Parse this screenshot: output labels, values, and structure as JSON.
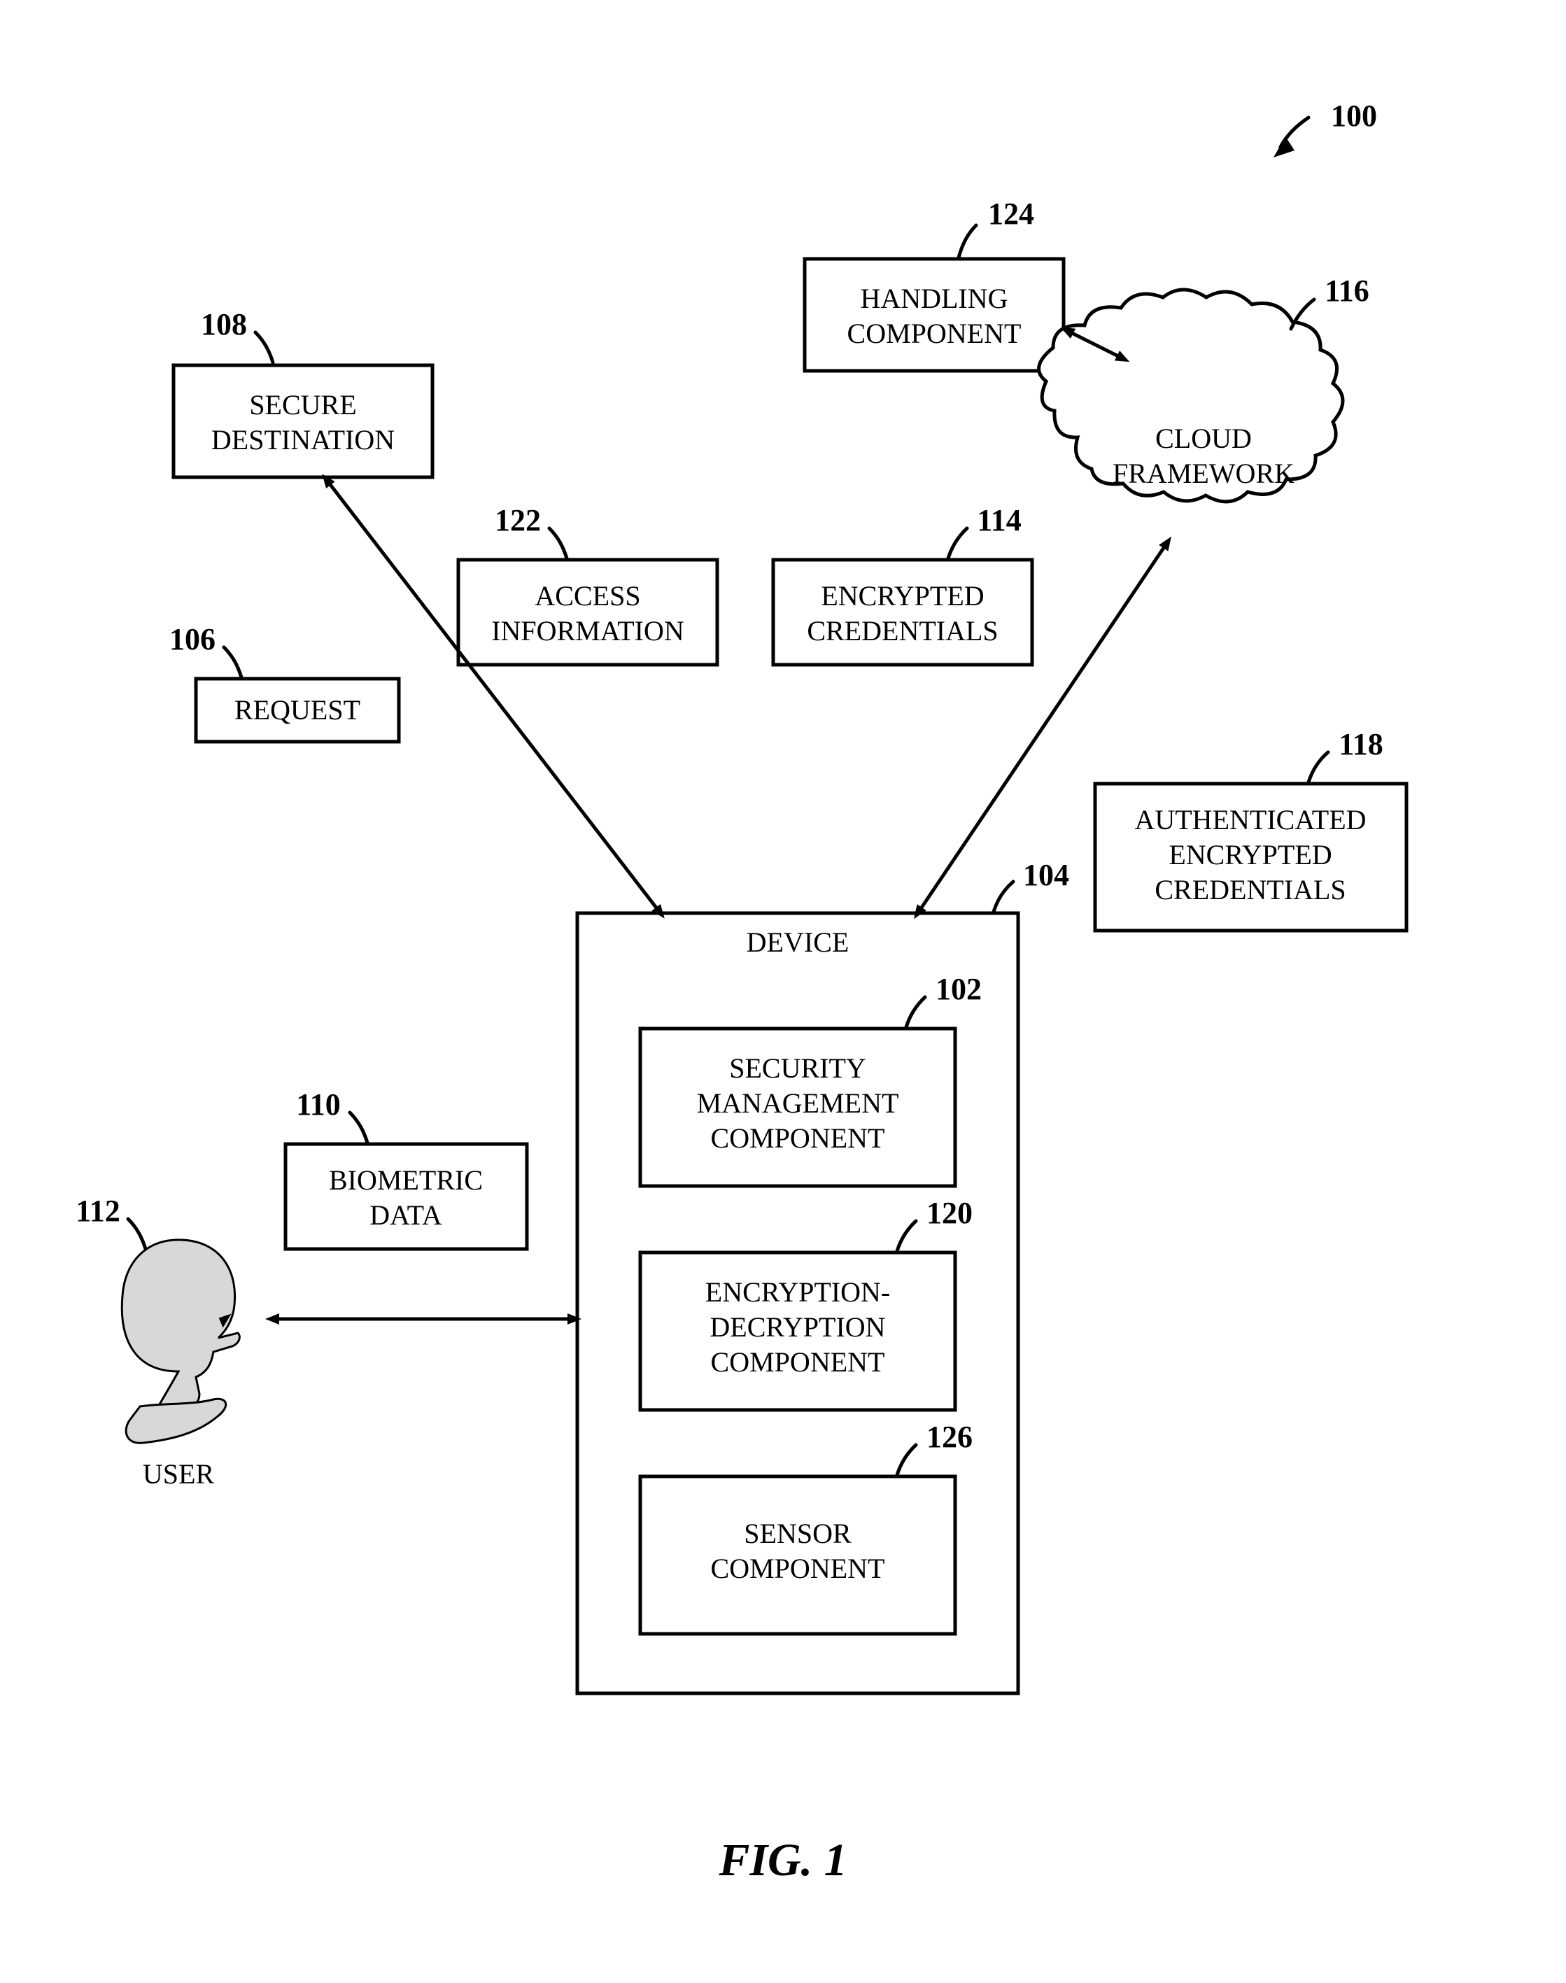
{
  "figure_caption": "FIG. 1",
  "diagram_ref": "100",
  "nodes": {
    "secure_destination": {
      "label_l1": "SECURE",
      "label_l2": "DESTINATION",
      "ref": "108"
    },
    "handling_component": {
      "label_l1": "HANDLING",
      "label_l2": "COMPONENT",
      "ref": "124"
    },
    "cloud": {
      "label_l1": "CLOUD",
      "label_l2": "FRAMEWORK",
      "ref": "116"
    },
    "access_info": {
      "label_l1": "ACCESS",
      "label_l2": "INFORMATION",
      "ref": "122"
    },
    "encrypted_credentials": {
      "label_l1": "ENCRYPTED",
      "label_l2": "CREDENTIALS",
      "ref": "114"
    },
    "request": {
      "label": "REQUEST",
      "ref": "106"
    },
    "auth_enc_cred": {
      "label_l1": "AUTHENTICATED",
      "label_l2": "ENCRYPTED",
      "label_l3": "CREDENTIALS",
      "ref": "118"
    },
    "device": {
      "label": "DEVICE",
      "ref": "104"
    },
    "security_mgmt": {
      "label_l1": "SECURITY",
      "label_l2": "MANAGEMENT",
      "label_l3": "COMPONENT",
      "ref": "102"
    },
    "enc_dec": {
      "label_l1": "ENCRYPTION-",
      "label_l2": "DECRYPTION",
      "label_l3": "COMPONENT",
      "ref": "120"
    },
    "sensor": {
      "label_l1": "SENSOR",
      "label_l2": "COMPONENT",
      "ref": "126"
    },
    "biometric": {
      "label_l1": "BIOMETRIC",
      "label_l2": "DATA",
      "ref": "110"
    },
    "user": {
      "label": "USER",
      "ref": "112"
    }
  }
}
